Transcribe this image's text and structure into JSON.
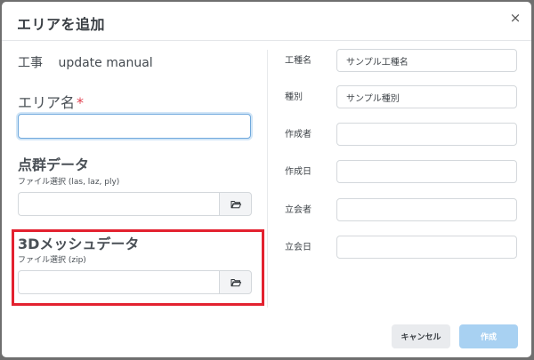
{
  "dialog": {
    "title": "エリアを追加",
    "close_glyph": "×"
  },
  "project": {
    "label": "工事",
    "value": "update manual"
  },
  "area_name": {
    "label": "エリア名",
    "required_mark": "*",
    "value": ""
  },
  "point_cloud": {
    "title": "点群データ",
    "hint": "ファイル選択 (las, laz, ply)"
  },
  "mesh": {
    "title": "3Dメッシュデータ",
    "hint": "ファイル選択 (zip)"
  },
  "fields": {
    "kind": {
      "label": "工種名",
      "value": "サンプル工種名"
    },
    "type": {
      "label": "種別",
      "value": "サンプル種別"
    },
    "author": {
      "label": "作成者",
      "value": ""
    },
    "created": {
      "label": "作成日",
      "value": ""
    },
    "witness": {
      "label": "立会者",
      "value": ""
    },
    "witness_date": {
      "label": "立会日",
      "value": ""
    }
  },
  "footer": {
    "cancel_label": "キャンセル",
    "create_label": "作成"
  },
  "colors": {
    "highlight": "#e3212f",
    "primary_disabled": "#a8d1f2",
    "required": "#e0404f"
  }
}
